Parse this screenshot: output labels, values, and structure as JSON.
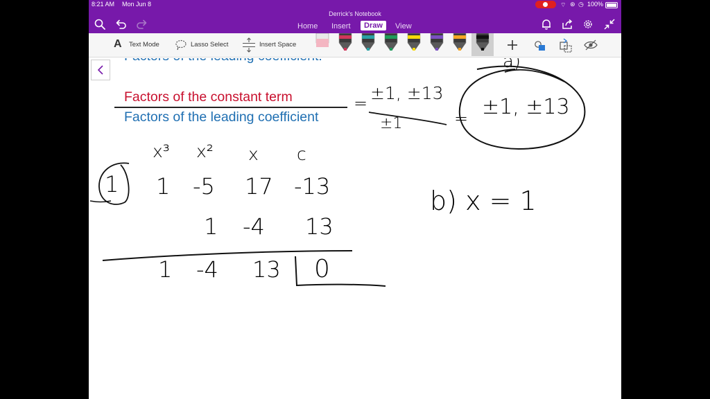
{
  "status": {
    "time": "8:21 AM",
    "date": "Mon Jun 8",
    "battery": "100%"
  },
  "app": {
    "notebook_title": "Derrick's Notebook",
    "tabs": [
      {
        "label": "Home"
      },
      {
        "label": "Insert"
      },
      {
        "label": "Draw",
        "active": true
      },
      {
        "label": "View"
      }
    ],
    "accent_color": "#7719aa"
  },
  "toolbar": {
    "text_mode": "Text Mode",
    "lasso_select": "Lasso Select",
    "insert_space": "Insert Space",
    "pens": [
      {
        "name": "eraser",
        "color": "#f4b6c2"
      },
      {
        "name": "pen-red",
        "color": "#d1365b"
      },
      {
        "name": "pen-teal",
        "color": "#2aa0a4"
      },
      {
        "name": "pen-green",
        "color": "#1f9a5b"
      },
      {
        "name": "highlighter-yellow",
        "color": "#f5d90a"
      },
      {
        "name": "pen-purple",
        "color": "#7a4fc0"
      },
      {
        "name": "highlighter-orange",
        "color": "#f5a623"
      },
      {
        "name": "pen-black",
        "color": "#111111"
      }
    ]
  },
  "page": {
    "cut_off_line": "Factors of the leading coefficient:",
    "numerator": "Factors of the constant term",
    "denominator": "Factors of the leading coefficient",
    "numerator_color": "#c8102e",
    "denominator_color": "#1f6fb2"
  },
  "handwriting": {
    "part_a_label": "a)",
    "ratio_numerator": "±1, ±13",
    "ratio_denominator": "±1",
    "equals": "=",
    "candidates": "±1, ±13",
    "headers": [
      "x³",
      "x²",
      "x",
      "c"
    ],
    "test_value": "1",
    "coefficients": [
      "1",
      "-5",
      "17",
      "-13"
    ],
    "products": [
      "1",
      "-4",
      "13"
    ],
    "results": [
      "1",
      "-4",
      "13"
    ],
    "remainder": "0",
    "part_b": "b) x = 1"
  }
}
